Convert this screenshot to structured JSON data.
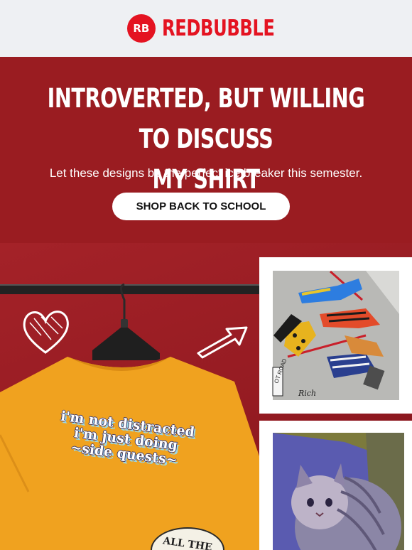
{
  "brand": {
    "name": "REDBUBBLE",
    "mark": "RB"
  },
  "hero": {
    "headline_line1": "INTROVERTED, BUT WILLING TO DISCUSS",
    "headline_line2": "MY SHIRT",
    "subtext": "Let these designs be the perfect ice breaker this semester.",
    "cta_label": "SHOP BACK TO SCHOOL"
  },
  "shirt": {
    "line1": "i'm not distracted",
    "line2": "i'm just doing",
    "line3": "~side quests~",
    "sticker_text": "ALL THE"
  },
  "art1": {
    "signature": "Rich",
    "sign_text": "OT ROAD"
  },
  "colors": {
    "brand_red": "#e41321",
    "hero_bg": "#9a1c21",
    "shirt": "#f0a21f",
    "header_bg": "#eef0f3"
  },
  "icons": [
    "heart-doodle-icon",
    "arrow-doodle-icon",
    "hanger-icon"
  ]
}
